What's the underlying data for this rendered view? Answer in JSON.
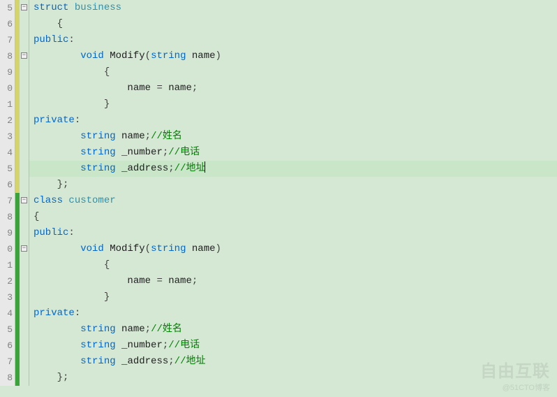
{
  "editor": {
    "lines": [
      {
        "num": "5",
        "change": "y",
        "fold": "minus",
        "tokens": [
          [
            "kw",
            "struct"
          ],
          [
            "",
            ""
          ],
          [
            "cls",
            "business"
          ]
        ],
        "indent": 0
      },
      {
        "num": "6",
        "change": "y",
        "fold": "",
        "tokens": [
          [
            "punc",
            "{"
          ]
        ],
        "indent": 1
      },
      {
        "num": "7",
        "change": "y",
        "fold": "",
        "tokens": [
          [
            "kw",
            "public"
          ],
          [
            "punc",
            ":"
          ]
        ],
        "indent": 0
      },
      {
        "num": "8",
        "change": "y",
        "fold": "minus",
        "tokens": [
          [
            "kw",
            "void"
          ],
          [
            "",
            " "
          ],
          [
            "id",
            "Modify"
          ],
          [
            "punc",
            "("
          ],
          [
            "type",
            "string"
          ],
          [
            "",
            " "
          ],
          [
            "id",
            "name"
          ],
          [
            "punc",
            ")"
          ]
        ],
        "indent": 2
      },
      {
        "num": "9",
        "change": "y",
        "fold": "",
        "tokens": [
          [
            "punc",
            "{"
          ]
        ],
        "indent": 3
      },
      {
        "num": "0",
        "change": "y",
        "fold": "",
        "tokens": [
          [
            "id",
            "name"
          ],
          [
            "",
            " "
          ],
          [
            "punc",
            "="
          ],
          [
            "",
            " "
          ],
          [
            "id",
            "name"
          ],
          [
            "punc",
            ";"
          ]
        ],
        "indent": 4
      },
      {
        "num": "1",
        "change": "y",
        "fold": "",
        "tokens": [
          [
            "punc",
            "}"
          ]
        ],
        "indent": 3
      },
      {
        "num": "2",
        "change": "y",
        "fold": "",
        "tokens": [
          [
            "kw",
            "private"
          ],
          [
            "punc",
            ":"
          ]
        ],
        "indent": 0
      },
      {
        "num": "3",
        "change": "y",
        "fold": "",
        "tokens": [
          [
            "type",
            "string"
          ],
          [
            "",
            " "
          ],
          [
            "id",
            "name"
          ],
          [
            "punc",
            ";"
          ],
          [
            "cmt",
            "//姓名"
          ]
        ],
        "indent": 2
      },
      {
        "num": "4",
        "change": "y",
        "fold": "",
        "tokens": [
          [
            "type",
            "string"
          ],
          [
            "",
            " "
          ],
          [
            "id",
            "_number"
          ],
          [
            "punc",
            ";"
          ],
          [
            "cmt",
            "//电话"
          ]
        ],
        "indent": 2
      },
      {
        "num": "5",
        "change": "y",
        "fold": "",
        "tokens": [
          [
            "type",
            "string"
          ],
          [
            "",
            " "
          ],
          [
            "id",
            "_address"
          ],
          [
            "punc",
            ";"
          ],
          [
            "cmt",
            "//地址"
          ]
        ],
        "indent": 2,
        "highlight": true,
        "caret": true
      },
      {
        "num": "6",
        "change": "y",
        "fold": "",
        "tokens": [
          [
            "punc",
            "};"
          ]
        ],
        "indent": 1
      },
      {
        "num": "7",
        "change": "g",
        "fold": "minus",
        "tokens": [
          [
            "kw",
            "class"
          ],
          [
            "",
            " "
          ],
          [
            "cls",
            "customer"
          ]
        ],
        "indent": 0
      },
      {
        "num": "8",
        "change": "g",
        "fold": "",
        "tokens": [
          [
            "punc",
            "{"
          ]
        ],
        "indent": 0
      },
      {
        "num": "9",
        "change": "g",
        "fold": "",
        "tokens": [
          [
            "kw",
            "public"
          ],
          [
            "punc",
            ":"
          ]
        ],
        "indent": 0
      },
      {
        "num": "0",
        "change": "g",
        "fold": "minus",
        "tokens": [
          [
            "kw",
            "void"
          ],
          [
            "",
            " "
          ],
          [
            "id",
            "Modify"
          ],
          [
            "punc",
            "("
          ],
          [
            "type",
            "string"
          ],
          [
            "",
            " "
          ],
          [
            "id",
            "name"
          ],
          [
            "punc",
            ")"
          ]
        ],
        "indent": 2
      },
      {
        "num": "1",
        "change": "g",
        "fold": "",
        "tokens": [
          [
            "punc",
            "{"
          ]
        ],
        "indent": 3
      },
      {
        "num": "2",
        "change": "g",
        "fold": "",
        "tokens": [
          [
            "id",
            "name"
          ],
          [
            "",
            " "
          ],
          [
            "punc",
            "="
          ],
          [
            "",
            " "
          ],
          [
            "id",
            "name"
          ],
          [
            "punc",
            ";"
          ]
        ],
        "indent": 4
      },
      {
        "num": "3",
        "change": "g",
        "fold": "",
        "tokens": [
          [
            "punc",
            "}"
          ]
        ],
        "indent": 3
      },
      {
        "num": "4",
        "change": "g",
        "fold": "",
        "tokens": [
          [
            "kw",
            "private"
          ],
          [
            "punc",
            ":"
          ]
        ],
        "indent": 0
      },
      {
        "num": "5",
        "change": "g",
        "fold": "",
        "tokens": [
          [
            "type",
            "string"
          ],
          [
            "",
            " "
          ],
          [
            "id",
            "name"
          ],
          [
            "punc",
            ";"
          ],
          [
            "cmt",
            "//姓名"
          ]
        ],
        "indent": 2
      },
      {
        "num": "6",
        "change": "g",
        "fold": "",
        "tokens": [
          [
            "type",
            "string"
          ],
          [
            "",
            " "
          ],
          [
            "id",
            "_number"
          ],
          [
            "punc",
            ";"
          ],
          [
            "cmt",
            "//电话"
          ]
        ],
        "indent": 2
      },
      {
        "num": "7",
        "change": "g",
        "fold": "",
        "tokens": [
          [
            "type",
            "string"
          ],
          [
            "",
            " "
          ],
          [
            "id",
            "_address"
          ],
          [
            "punc",
            ";"
          ],
          [
            "cmt",
            "//地址"
          ]
        ],
        "indent": 2
      },
      {
        "num": "8",
        "change": "g",
        "fold": "",
        "tokens": [
          [
            "punc",
            "};"
          ]
        ],
        "indent": 1
      }
    ]
  },
  "watermark": {
    "line1": "自由互联",
    "line2": "@51CTO博客"
  }
}
